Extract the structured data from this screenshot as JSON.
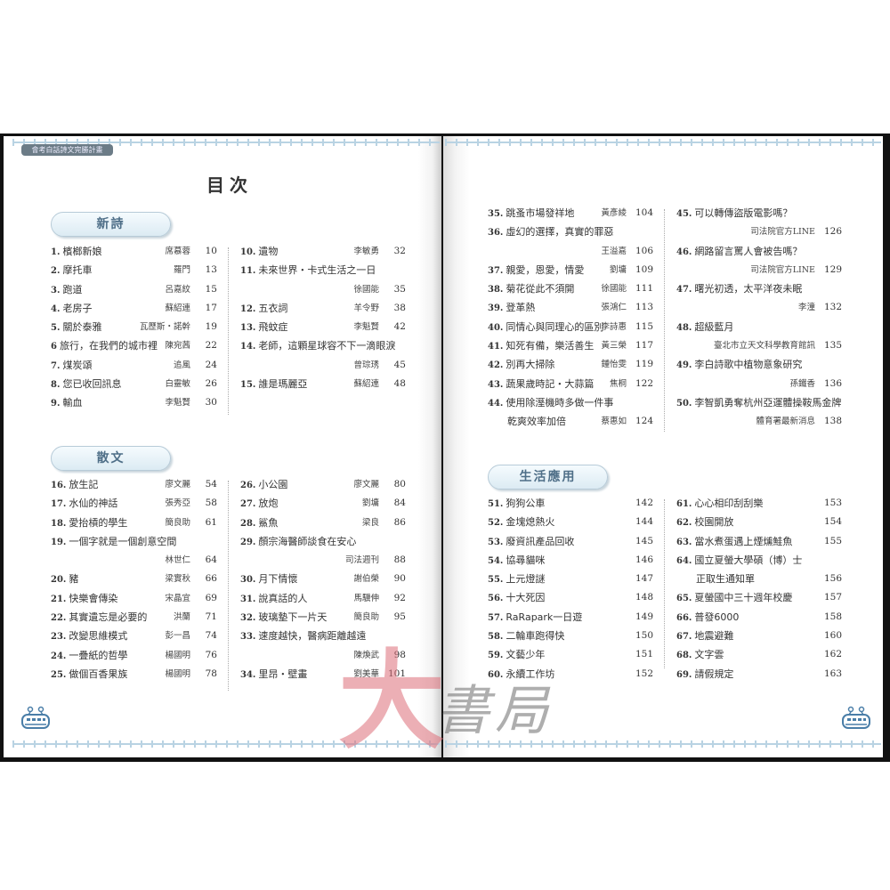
{
  "header": {
    "series_tag": "會考白話詩文完勝計畫",
    "toc_title": "目次"
  },
  "watermark": "大書局",
  "sections": {
    "poetry": {
      "label": "新詩"
    },
    "prose": {
      "label": "散文"
    },
    "practical": {
      "label": "生活應用"
    }
  },
  "columns": [
    [
      {
        "num": "1.",
        "title": "檳榔新娘",
        "author": "席慕蓉",
        "page": "10"
      },
      {
        "num": "2.",
        "title": "摩托車",
        "author": "羅門",
        "page": "13"
      },
      {
        "num": "3.",
        "title": "跑道",
        "author": "呂嘉紋",
        "page": "15"
      },
      {
        "num": "4.",
        "title": "老房子",
        "author": "蘇紹連",
        "page": "17"
      },
      {
        "num": "5.",
        "title": "關於泰雅",
        "author": "瓦歷斯・諾幹",
        "page": "19"
      },
      {
        "num": "6",
        "title": "旅行，在我們的城市裡",
        "author": "陳宛茜",
        "page": "22"
      },
      {
        "num": "7.",
        "title": "煤炭頌",
        "author": "追風",
        "page": "24"
      },
      {
        "num": "8.",
        "title": "您已收回訊息",
        "author": "白靈敏",
        "page": "26"
      },
      {
        "num": "9.",
        "title": "輸血",
        "author": "李魁賢",
        "page": "30"
      }
    ],
    [
      {
        "num": "10.",
        "title": "遺物",
        "author": "李敏勇",
        "page": "32"
      },
      {
        "num": "11.",
        "title": "未來世界・卡式生活之一日",
        "wrap": true,
        "author": "徐國能",
        "page": "35"
      },
      {
        "num": "12.",
        "title": "五衣詞",
        "author": "羊令野",
        "page": "38"
      },
      {
        "num": "13.",
        "title": "飛蚊症",
        "author": "李魁賢",
        "page": "42"
      },
      {
        "num": "14.",
        "title": "老師，這顆星球容不下一滴眼淚",
        "wrap": true,
        "author": "曾琮琇",
        "page": "45"
      },
      {
        "num": "15.",
        "title": "誰是瑪麗亞",
        "author": "蘇紹連",
        "page": "48"
      }
    ],
    [
      {
        "num": "16.",
        "title": "放生記",
        "author": "廖文麗",
        "page": "54"
      },
      {
        "num": "17.",
        "title": "水仙的神話",
        "author": "張秀亞",
        "page": "58"
      },
      {
        "num": "18.",
        "title": "愛抬槓的學生",
        "author": "簡良助",
        "page": "61"
      },
      {
        "num": "19.",
        "title": "一個字就是一個創意空間",
        "wrap": true,
        "author": "林世仁",
        "page": "64"
      },
      {
        "num": "20.",
        "title": "豬",
        "author": "梁實秋",
        "page": "66"
      },
      {
        "num": "21.",
        "title": "快樂會傳染",
        "author": "宋晶宜",
        "page": "69"
      },
      {
        "num": "22.",
        "title": "其實遺忘是必要的",
        "author": "洪蘭",
        "page": "71"
      },
      {
        "num": "23.",
        "title": "改變思維模式",
        "author": "彭一昌",
        "page": "74"
      },
      {
        "num": "24.",
        "title": "一疊紙的哲學",
        "author": "楊國明",
        "page": "76"
      },
      {
        "num": "25.",
        "title": "做個百香果族",
        "author": "楊國明",
        "page": "78"
      }
    ],
    [
      {
        "num": "26.",
        "title": "小公園",
        "author": "廖文麗",
        "page": "80"
      },
      {
        "num": "27.",
        "title": "放炮",
        "author": "劉墉",
        "page": "84"
      },
      {
        "num": "28.",
        "title": "鯊魚",
        "author": "梁良",
        "page": "86"
      },
      {
        "num": "29.",
        "title": "顏宗海醫師談食在安心",
        "wrap": true,
        "author": "司法週刊",
        "page": "88"
      },
      {
        "num": "30.",
        "title": "月下情懷",
        "author": "謝伯榮",
        "page": "90"
      },
      {
        "num": "31.",
        "title": "說真話的人",
        "author": "馬驥伸",
        "page": "92"
      },
      {
        "num": "32.",
        "title": "玻璃墊下一片天",
        "author": "簡良助",
        "page": "95"
      },
      {
        "num": "33.",
        "title": "速度越快，醫病距離越遠",
        "wrap": true,
        "author": "陳煥武",
        "page": "98"
      },
      {
        "num": "34.",
        "title": "里昂・壁畫",
        "author": "劉美華",
        "page": "101"
      }
    ],
    [
      {
        "num": "35.",
        "title": "跳蚤市場發祥地",
        "author": "黃彥綾",
        "page": "104"
      },
      {
        "num": "36.",
        "title": "虛幻的選擇，真實的罪惡",
        "wrap": true,
        "author": "王溢嘉",
        "page": "106"
      },
      {
        "num": "37.",
        "title": "親愛，恩愛，情愛",
        "author": "劉墉",
        "page": "109"
      },
      {
        "num": "38.",
        "title": "菊花從此不須開",
        "author": "徐國能",
        "page": "111"
      },
      {
        "num": "39.",
        "title": "登革熱",
        "author": "張鴻仁",
        "page": "113"
      },
      {
        "num": "40.",
        "title": "同情心與同理心的區別",
        "author": "李詩惠",
        "page": "115"
      },
      {
        "num": "41.",
        "title": "知死有備，樂活善生",
        "author": "黃三榮",
        "page": "117"
      },
      {
        "num": "42.",
        "title": "別再大掃除",
        "author": "鍾怡雯",
        "page": "119"
      },
      {
        "num": "43.",
        "title": "蔬果歲時記・大蒜篇",
        "author": "焦桐",
        "page": "122"
      },
      {
        "num": "44.",
        "title": "使用除溼機時多做一件事",
        "title2": "乾爽效率加倍",
        "author": "蔡惠如",
        "page": "124"
      }
    ],
    [
      {
        "num": "45.",
        "title": "可以轉傳盜版電影嗎？",
        "wrap": true,
        "author": "司法院官方LINE",
        "page": "126"
      },
      {
        "num": "46.",
        "title": "網路留言罵人會被告嗎？",
        "wrap": true,
        "author": "司法院官方LINE",
        "page": "129"
      },
      {
        "num": "47.",
        "title": "曙光初透，太平洋夜未眠",
        "wrap": true,
        "author": "李潼",
        "page": "132"
      },
      {
        "num": "48.",
        "title": "超級藍月",
        "wrap": true,
        "author": "臺北市立天文科學教育館訊",
        "page": "135"
      },
      {
        "num": "49.",
        "title": "李白詩歌中植物意象研究",
        "wrap": true,
        "author": "孫鐵香",
        "page": "136"
      },
      {
        "num": "50.",
        "title": "李智凱勇奪杭州亞運體操鞍馬金牌",
        "wrap": true,
        "author": "體育署最新消息",
        "page": "138"
      }
    ],
    [
      {
        "num": "51.",
        "title": "狗狗公車",
        "page": "142"
      },
      {
        "num": "52.",
        "title": "金塊熄熱火",
        "page": "144"
      },
      {
        "num": "53.",
        "title": "廢資訊產品回收",
        "page": "145"
      },
      {
        "num": "54.",
        "title": "協尋貓咪",
        "page": "146"
      },
      {
        "num": "55.",
        "title": "上元燈謎",
        "page": "147"
      },
      {
        "num": "56.",
        "title": "十大死因",
        "page": "148"
      },
      {
        "num": "57.",
        "title": "RaRapark一日遊",
        "page": "149"
      },
      {
        "num": "58.",
        "title": "二輪車跑得快",
        "page": "150"
      },
      {
        "num": "59.",
        "title": "文藝少年",
        "page": "151"
      },
      {
        "num": "60.",
        "title": "永續工作坊",
        "page": "152"
      }
    ],
    [
      {
        "num": "61.",
        "title": "心心相印刮刮樂",
        "page": "153"
      },
      {
        "num": "62.",
        "title": "校園開放",
        "page": "154"
      },
      {
        "num": "63.",
        "title": "當水煮蛋遇上煙燻鮭魚",
        "page": "155"
      },
      {
        "num": "64.",
        "title": "國立夏螢大學碩（博）士",
        "title2": "正取生通知單",
        "page": "156"
      },
      {
        "num": "65.",
        "title": "夏螢國中三十週年校慶",
        "page": "157"
      },
      {
        "num": "66.",
        "title": "普發6000",
        "page": "158"
      },
      {
        "num": "67.",
        "title": "地震避難",
        "page": "160"
      },
      {
        "num": "68.",
        "title": "文字雲",
        "page": "162"
      },
      {
        "num": "69.",
        "title": "請假規定",
        "page": "163"
      }
    ]
  ]
}
